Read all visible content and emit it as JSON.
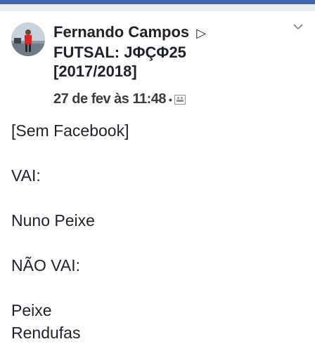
{
  "post": {
    "author": "Fernando Campos",
    "share_arrow": "▷",
    "group_line1": "FUTSAL: JΦÇΦ25",
    "group_line2": "[2017/2018]",
    "timestamp": "27 de fev às 11:48",
    "separator": "•",
    "audience_icon": "group-audience-icon",
    "options_icon": "chevron-down-icon",
    "body_lines": [
      "[Sem Facebook]",
      "",
      "VAI:",
      "",
      "Nuno Peixe",
      "",
      "NÃO VAI:",
      "",
      "Peixe",
      "Rendufas"
    ]
  },
  "colors": {
    "brand_blue": "#4267b2",
    "text": "#1d2129",
    "muted": "#90949c"
  }
}
